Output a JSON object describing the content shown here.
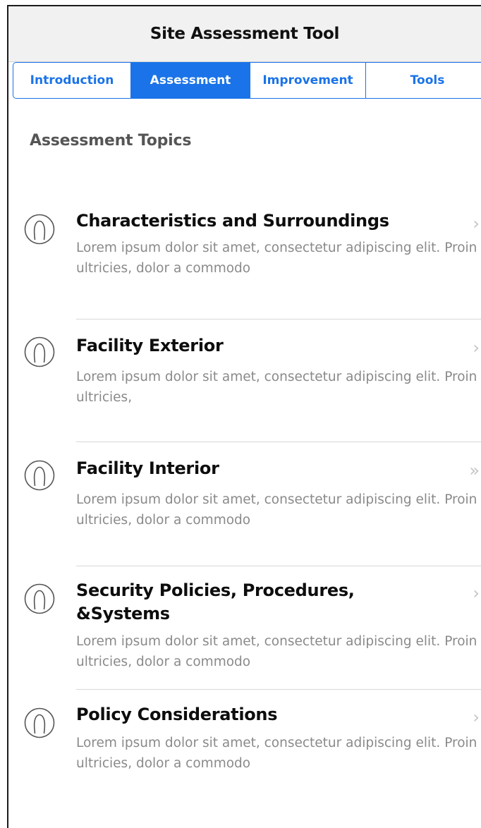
{
  "header": {
    "title": "Site Assessment Tool"
  },
  "tabs": [
    {
      "label": "Introduction",
      "active": false
    },
    {
      "label": "Assessment",
      "active": true
    },
    {
      "label": "Improvement",
      "active": false
    },
    {
      "label": "Tools",
      "active": false
    }
  ],
  "section": {
    "title": "Assessment Topics"
  },
  "topics": [
    {
      "title": "Characteristics and Surroundings",
      "description": "Lorem ipsum dolor sit amet, consectetur adipiscing elit. Proin ultricies, dolor a commodo",
      "chevron": "›",
      "icon": "person-icon"
    },
    {
      "title": "Facility Exterior",
      "description": "Lorem ipsum dolor sit amet, consectetur adipiscing elit. Proin ultricies,",
      "chevron": "›",
      "icon": "person-icon"
    },
    {
      "title": "Facility Interior",
      "description": "Lorem ipsum dolor sit amet, consectetur adipiscing elit. Proin ultricies, dolor a commodo",
      "chevron": "»",
      "icon": "person-icon"
    },
    {
      "title": "Security Policies, Procedures, &Systems",
      "description": "Lorem ipsum dolor sit amet, consectetur adipiscing elit. Proin ultricies, dolor a commodo",
      "chevron": "›",
      "icon": "person-icon"
    },
    {
      "title": "Policy Considerations",
      "description": "Lorem ipsum dolor sit amet, consectetur adipiscing elit. Proin ultricies, dolor a commodo",
      "chevron": "›",
      "icon": "person-icon"
    }
  ],
  "colors": {
    "accent": "#1a73e8",
    "title_text": "#0d0d0d",
    "description_text": "#8a8a8a",
    "section_text": "#555555",
    "header_background": "#f1f1f1"
  }
}
